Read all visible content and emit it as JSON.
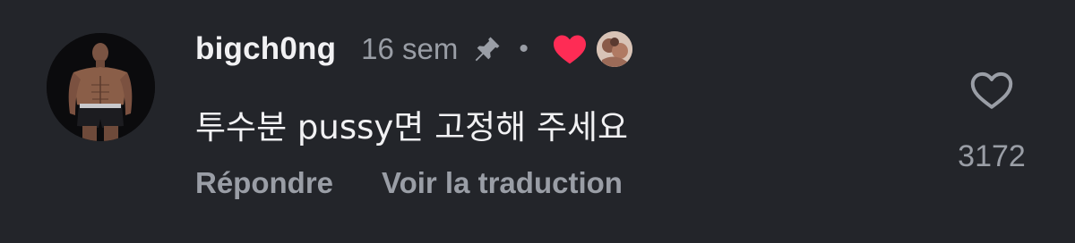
{
  "comment": {
    "username": "bigch0ng",
    "time": "16 sem",
    "separator": "•",
    "text": "투수분 pussy면 고정해 주세요",
    "actions": {
      "reply_label": "Répondre",
      "translate_label": "Voir la traduction"
    },
    "likes": {
      "count": "3172"
    },
    "icons": {
      "pin": "pin-icon",
      "creator_heart": "heart-filled-icon",
      "like": "heart-outline-icon"
    },
    "colors": {
      "background": "#23252a",
      "primary_text": "#f1f1f3",
      "secondary_text": "#9a9ea6",
      "creator_heart": "#fe2c55"
    }
  }
}
